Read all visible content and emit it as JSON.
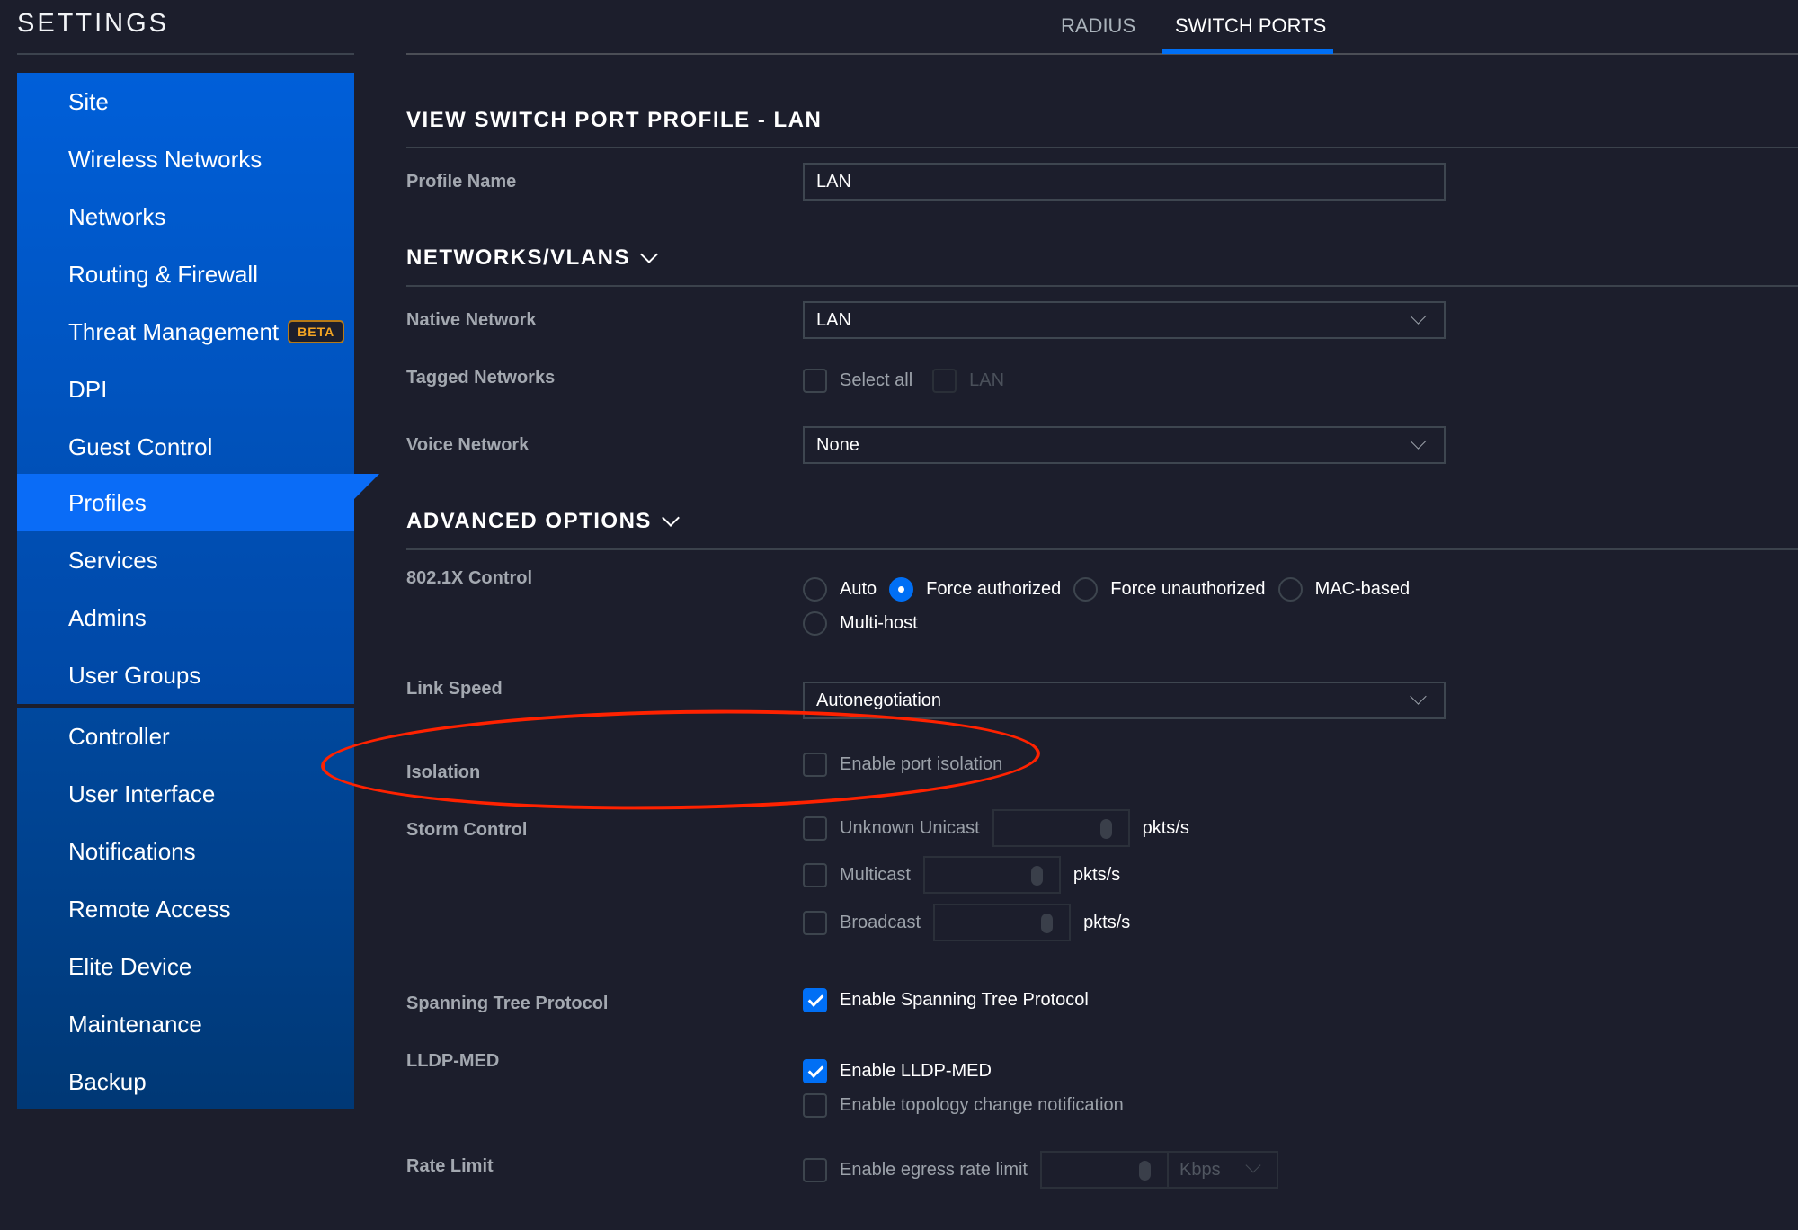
{
  "sidebar": {
    "title": "SETTINGS",
    "items": [
      {
        "label": "Site"
      },
      {
        "label": "Wireless Networks"
      },
      {
        "label": "Networks"
      },
      {
        "label": "Routing & Firewall"
      },
      {
        "label": "Threat Management",
        "badge": "BETA"
      },
      {
        "label": "DPI"
      },
      {
        "label": "Guest Control"
      },
      {
        "label": "Profiles",
        "active": true
      },
      {
        "label": "Services"
      },
      {
        "label": "Admins"
      },
      {
        "label": "User Groups"
      }
    ],
    "items2": [
      {
        "label": "Controller"
      },
      {
        "label": "User Interface"
      },
      {
        "label": "Notifications"
      },
      {
        "label": "Remote Access"
      },
      {
        "label": "Elite Device"
      },
      {
        "label": "Maintenance"
      },
      {
        "label": "Backup"
      }
    ]
  },
  "tabs": [
    {
      "label": "RADIUS"
    },
    {
      "label": "SWITCH PORTS",
      "active": true
    }
  ],
  "main": {
    "title": "VIEW SWITCH PORT PROFILE - LAN",
    "profile_name": {
      "label": "Profile Name",
      "value": "LAN"
    },
    "networks": {
      "heading": "NETWORKS/VLANS",
      "native": {
        "label": "Native Network",
        "value": "LAN"
      },
      "tagged": {
        "label": "Tagged Networks",
        "select_all": "Select all",
        "option": "LAN"
      },
      "voice": {
        "label": "Voice Network",
        "value": "None"
      }
    },
    "advanced": {
      "heading": "ADVANCED OPTIONS",
      "dot1x": {
        "label": "802.1X Control",
        "options": [
          "Auto",
          "Force authorized",
          "Force unauthorized",
          "MAC-based",
          "Multi-host"
        ],
        "selected": "Force authorized"
      },
      "link_speed": {
        "label": "Link Speed",
        "value": "Autonegotiation"
      },
      "isolation": {
        "label": "Isolation",
        "option": "Enable port isolation",
        "checked": false
      },
      "storm": {
        "label": "Storm Control",
        "rows": [
          {
            "label": "Unknown Unicast",
            "unit": "pkts/s",
            "value": ""
          },
          {
            "label": "Multicast",
            "unit": "pkts/s",
            "value": ""
          },
          {
            "label": "Broadcast",
            "unit": "pkts/s",
            "value": ""
          }
        ]
      },
      "stp": {
        "label": "Spanning Tree Protocol",
        "option": "Enable Spanning Tree Protocol",
        "checked": true
      },
      "lldp": {
        "label": "LLDP-MED",
        "option": "Enable LLDP-MED",
        "checked": true,
        "topology": "Enable topology change notification",
        "topology_checked": false
      },
      "rate_limit": {
        "label": "Rate Limit",
        "option": "Enable egress rate limit",
        "checked": false,
        "value": "",
        "unit": "Kbps"
      }
    }
  },
  "colors": {
    "background": "#1c1e2c",
    "accent": "#006ff5",
    "sidebar_top": "#005fd9",
    "sidebar_bottom": "#003875",
    "beta_badge": "#f5a623",
    "annotation": "#ff2200"
  }
}
